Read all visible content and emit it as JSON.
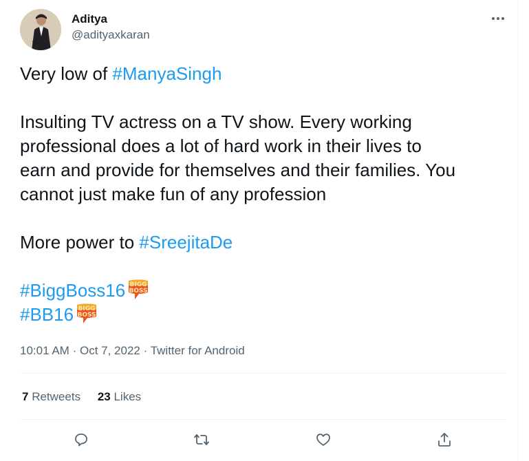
{
  "tweet": {
    "author": {
      "name": "Aditya",
      "handle": "@adityaxkaran"
    },
    "lines": [
      {
        "before": "Very low of ",
        "tag": "#ManyaSingh"
      },
      "",
      "Insulting TV actress on a TV show. Every working",
      "professional does a lot of hard work in their lives to",
      "earn and provide for themselves and their families. You",
      "cannot just make fun of any profession",
      "",
      {
        "before": "More power to ",
        "tag": "#SreejitaDe"
      },
      "",
      {
        "tag": "#BiggBoss16",
        "logo": "bigg-boss-logo"
      },
      {
        "tag": "#BB16",
        "logo": "bigg-boss-logo"
      }
    ],
    "meta": {
      "time": "10:01 AM",
      "separator": "·",
      "date": "Oct 7, 2022",
      "source": "Twitter for Android"
    },
    "stats": {
      "retweets": {
        "count": "7",
        "label": "Retweets"
      },
      "likes": {
        "count": "23",
        "label": "Likes"
      }
    },
    "logo_text": [
      "BIGG",
      "BOSS"
    ],
    "actions": [
      "reply-icon",
      "retweet-icon",
      "like-icon",
      "share-icon"
    ]
  },
  "colors": {
    "link": "#1d9bf0",
    "secondary": "#536471",
    "text": "#0f1419",
    "divider": "#eff3f4"
  }
}
